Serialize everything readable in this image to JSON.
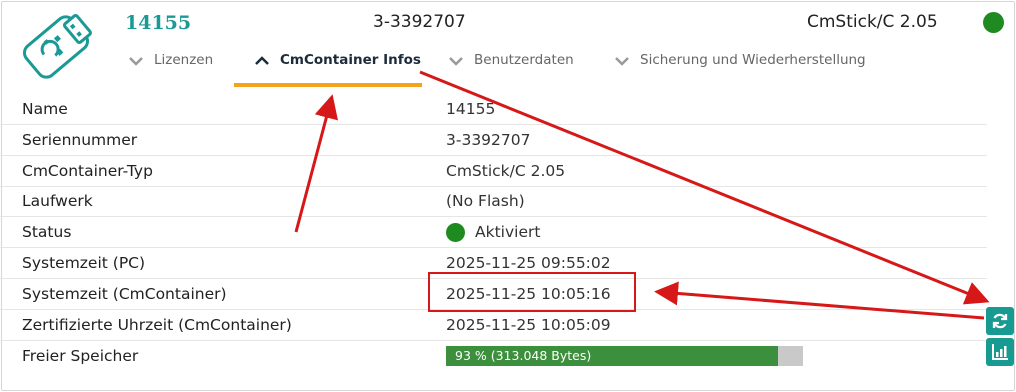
{
  "header": {
    "name": "14155",
    "serial": "3-3392707",
    "type": "CmStick/C 2.05",
    "status_color": "#1f8a1f",
    "logo_icon": "usb-stick-icon"
  },
  "tabs": [
    {
      "label": "Lizenzen",
      "active": false
    },
    {
      "label": "CmContainer Infos",
      "active": true
    },
    {
      "label": "Benutzerdaten",
      "active": false
    },
    {
      "label": "Sicherung und Wiederherstellung",
      "active": false
    }
  ],
  "info": {
    "name": {
      "label": "Name",
      "value": "14155"
    },
    "serial": {
      "label": "Seriennummer",
      "value": "3-3392707"
    },
    "container_type": {
      "label": "CmContainer-Typ",
      "value": "CmStick/C 2.05"
    },
    "drive": {
      "label": "Laufwerk",
      "value": "(No Flash)"
    },
    "status": {
      "label": "Status",
      "value": "Aktiviert"
    },
    "system_time_pc": {
      "label": "Systemzeit (PC)",
      "value": "2025-11-25 09:55:02"
    },
    "system_time_container": {
      "label": "Systemzeit (CmContainer)",
      "value": "2025-11-25 10:05:16"
    },
    "certified_time": {
      "label": "Zertifizierte Uhrzeit (CmContainer)",
      "value": "2025-11-25 10:05:09"
    },
    "free_memory": {
      "label": "Freier Speicher",
      "value": "93 % (313.048 Bytes)",
      "percent": 93
    }
  },
  "side_buttons": [
    "refresh-icon",
    "chart-icon"
  ],
  "colors": {
    "accent": "#179a92",
    "tab_underline": "#f5a31a",
    "annotation": "#d61818",
    "progress": "#3c8f3c"
  }
}
